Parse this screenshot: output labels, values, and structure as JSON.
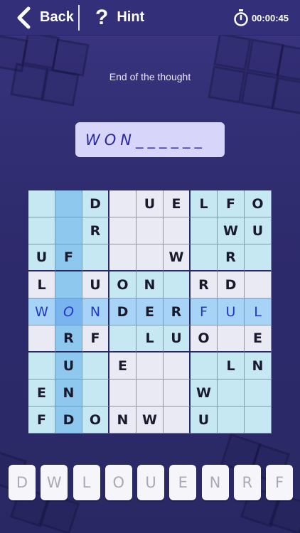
{
  "header": {
    "back_label": "Back",
    "hint_symbol": "?",
    "hint_label": "Hint",
    "timer": "00:00:45",
    "icons": {
      "back": "chevron-left-icon",
      "timer": "stopwatch-icon"
    }
  },
  "puzzle": {
    "clue": "End of the thought",
    "answer_progress": "WON______"
  },
  "grid": {
    "rows": [
      [
        "",
        "",
        "D",
        "",
        "U",
        "E",
        "L",
        "F",
        "O"
      ],
      [
        "",
        "",
        "R",
        "",
        "",
        "",
        "",
        "W",
        "U"
      ],
      [
        "U",
        "F",
        "",
        "",
        "",
        "W",
        "",
        "R",
        ""
      ],
      [
        "L",
        "",
        "U",
        "O",
        "N",
        "",
        "R",
        "D",
        ""
      ],
      [
        "W",
        "O",
        "N",
        "D",
        "E",
        "R",
        "F",
        "U",
        "L"
      ],
      [
        "",
        "R",
        "F",
        "",
        "L",
        "U",
        "O",
        "",
        "E"
      ],
      [
        "",
        "U",
        "",
        "E",
        "",
        "",
        "",
        "L",
        "N"
      ],
      [
        "E",
        "N",
        "",
        "",
        "",
        "",
        "W",
        "",
        ""
      ],
      [
        "F",
        "D",
        "O",
        "N",
        "W",
        "",
        "U",
        "",
        ""
      ]
    ],
    "fills": [
      [
        "light",
        "col",
        "light",
        "white",
        "white",
        "white",
        "light",
        "light",
        "light"
      ],
      [
        "light",
        "col",
        "light",
        "white",
        "white",
        "white",
        "light",
        "light",
        "light"
      ],
      [
        "light",
        "col",
        "light",
        "white",
        "white",
        "white",
        "light",
        "light",
        "light"
      ],
      [
        "white",
        "col",
        "white",
        "light",
        "light",
        "light",
        "white",
        "white",
        "white"
      ],
      [
        "row",
        "sel",
        "row",
        "row",
        "row",
        "row",
        "row",
        "row",
        "row"
      ],
      [
        "white",
        "col",
        "white",
        "light",
        "light",
        "light",
        "white",
        "white",
        "white"
      ],
      [
        "light",
        "col",
        "light",
        "white",
        "white",
        "white",
        "light",
        "light",
        "light"
      ],
      [
        "light",
        "col",
        "light",
        "white",
        "white",
        "white",
        "light",
        "light",
        "light"
      ],
      [
        "light",
        "col",
        "light",
        "white",
        "white",
        "white",
        "light",
        "light",
        "light"
      ]
    ],
    "blue_cells": [
      [
        4,
        0
      ],
      [
        4,
        1
      ],
      [
        4,
        2
      ],
      [
        4,
        6
      ],
      [
        4,
        7
      ],
      [
        4,
        8
      ]
    ],
    "colors": {
      "light": "#c6e8f3",
      "white": "#e9eaf3",
      "col": "#8ec8ef",
      "row": "#a6d3f6",
      "sel": "#7ab4ee"
    }
  },
  "keys": [
    "D",
    "W",
    "L",
    "O",
    "U",
    "E",
    "N",
    "R",
    "F"
  ]
}
